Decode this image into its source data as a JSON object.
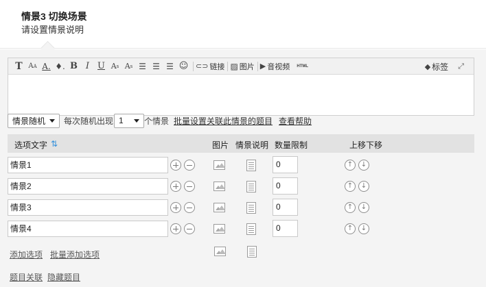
{
  "header": {
    "title": "情景3 切换场景",
    "subtitle": "请设置情景说明"
  },
  "toolbar": {
    "link_label": "链接",
    "image_label": "图片",
    "media_label": "音视频",
    "html_label": "HTML",
    "tag_label": "标签"
  },
  "settings": {
    "mode_select": "情景随机",
    "each_random_label": "每次随机出现",
    "count_select": "1",
    "unit_label": "个情景",
    "batch_link": "批量设置关联此情景的题目",
    "help_link": "查看帮助"
  },
  "table": {
    "headers": {
      "option_text": "选项文字",
      "sort_icon": "⇅",
      "image": "图片",
      "description": "情景说明",
      "quantity_limit": "数量限制",
      "move": "上移下移"
    },
    "rows": [
      {
        "label": "情景1",
        "limit": "0"
      },
      {
        "label": "情景2",
        "limit": "0"
      },
      {
        "label": "情景3",
        "limit": "0"
      },
      {
        "label": "情景4",
        "limit": "0"
      }
    ]
  },
  "actions": {
    "add_option": "添加选项",
    "batch_add_option": "批量添加选项",
    "question_relation": "题目关联",
    "hide_question": "隐藏题目"
  }
}
